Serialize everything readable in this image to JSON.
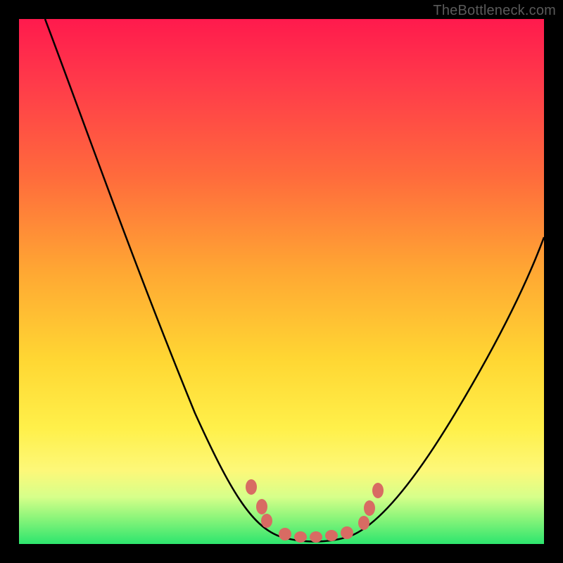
{
  "watermark": "TheBottleneck.com",
  "chart_data": {
    "type": "line",
    "title": "",
    "xlabel": "",
    "ylabel": "",
    "xlim": [
      0,
      100
    ],
    "ylim": [
      0,
      100
    ],
    "series": [
      {
        "name": "bottleneck-curve",
        "x": [
          5,
          10,
          15,
          20,
          25,
          30,
          35,
          40,
          45,
          47,
          50,
          53,
          56,
          59,
          62,
          65,
          70,
          75,
          80,
          85,
          90,
          95,
          100
        ],
        "values": [
          100,
          90,
          80,
          70,
          60,
          50,
          40,
          30,
          18,
          10,
          4,
          1,
          0,
          0,
          1,
          4,
          11,
          19,
          27,
          35,
          43,
          51,
          59
        ]
      }
    ],
    "markers": {
      "name": "highlight-dots",
      "x": [
        46,
        48,
        50,
        53,
        56,
        59,
        62,
        64,
        66
      ],
      "values": [
        12,
        7,
        3,
        1,
        0,
        0,
        2,
        5,
        10
      ],
      "color": "#d86b63"
    },
    "colors": {
      "curve": "#000000",
      "marker": "#d86b63",
      "gradient_top": "#ff1a4d",
      "gradient_mid": "#ffd733",
      "gradient_bottom": "#2de56e",
      "frame": "#000000"
    }
  }
}
